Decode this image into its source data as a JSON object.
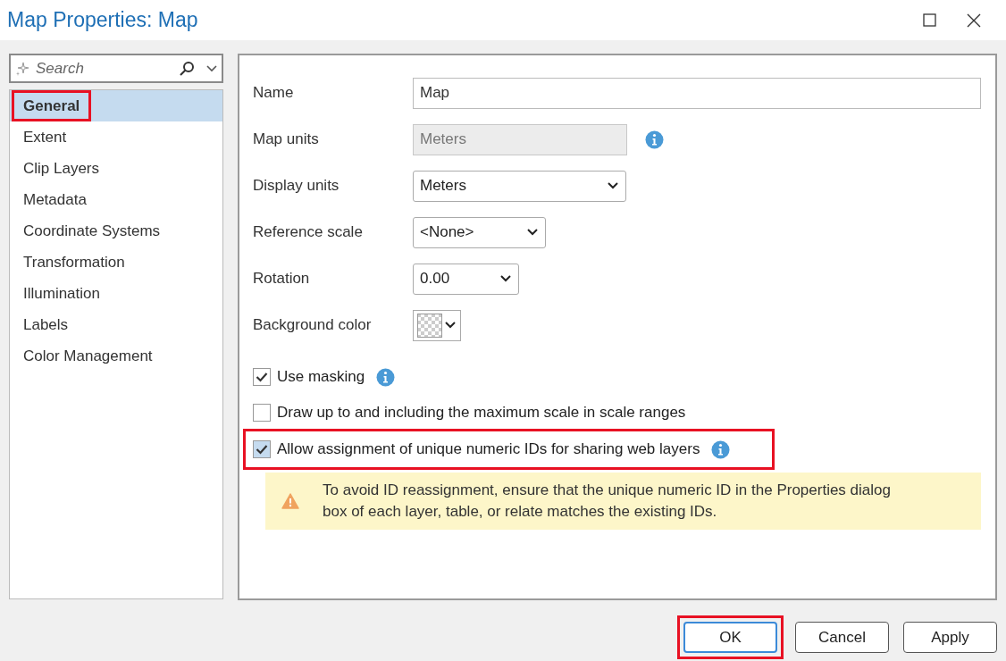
{
  "window": {
    "title": "Map Properties: Map"
  },
  "search": {
    "placeholder": "Search"
  },
  "sidebar": {
    "items": [
      {
        "label": "General",
        "selected": true,
        "highlighted": true
      },
      {
        "label": "Extent",
        "selected": false,
        "highlighted": false
      },
      {
        "label": "Clip Layers",
        "selected": false,
        "highlighted": false
      },
      {
        "label": "Metadata",
        "selected": false,
        "highlighted": false
      },
      {
        "label": "Coordinate Systems",
        "selected": false,
        "highlighted": false
      },
      {
        "label": "Transformation",
        "selected": false,
        "highlighted": false
      },
      {
        "label": "Illumination",
        "selected": false,
        "highlighted": false
      },
      {
        "label": "Labels",
        "selected": false,
        "highlighted": false
      },
      {
        "label": "Color Management",
        "selected": false,
        "highlighted": false
      }
    ]
  },
  "fields": [
    {
      "kind": "text",
      "label": "Name",
      "value": "Map",
      "info": false
    },
    {
      "kind": "disabled",
      "label": "Map units",
      "value": "Meters",
      "info": true
    },
    {
      "kind": "select",
      "label": "Display units",
      "value": "Meters",
      "info": false
    },
    {
      "kind": "select",
      "label": "Reference scale",
      "value": "<None>",
      "info": false
    },
    {
      "kind": "select",
      "label": "Rotation",
      "value": "0.00",
      "info": false
    },
    {
      "kind": "swatch",
      "label": "Background color",
      "info": false
    }
  ],
  "checkboxes": [
    {
      "label": "Use masking",
      "checked": true,
      "info": true,
      "highlighted": false
    },
    {
      "label": "Draw up to and including the maximum scale in scale ranges",
      "checked": false,
      "info": false,
      "highlighted": false
    },
    {
      "label": "Allow assignment of unique numeric IDs for sharing web layers",
      "checked": true,
      "info": true,
      "highlighted": true
    }
  ],
  "warning": {
    "text": "To avoid ID reassignment, ensure that the unique numeric ID in the Properties dialog box of each layer, table, or relate matches the existing IDs."
  },
  "buttons": [
    {
      "label": "OK",
      "highlighted": true
    },
    {
      "label": "Cancel",
      "highlighted": false
    },
    {
      "label": "Apply",
      "highlighted": false
    }
  ]
}
